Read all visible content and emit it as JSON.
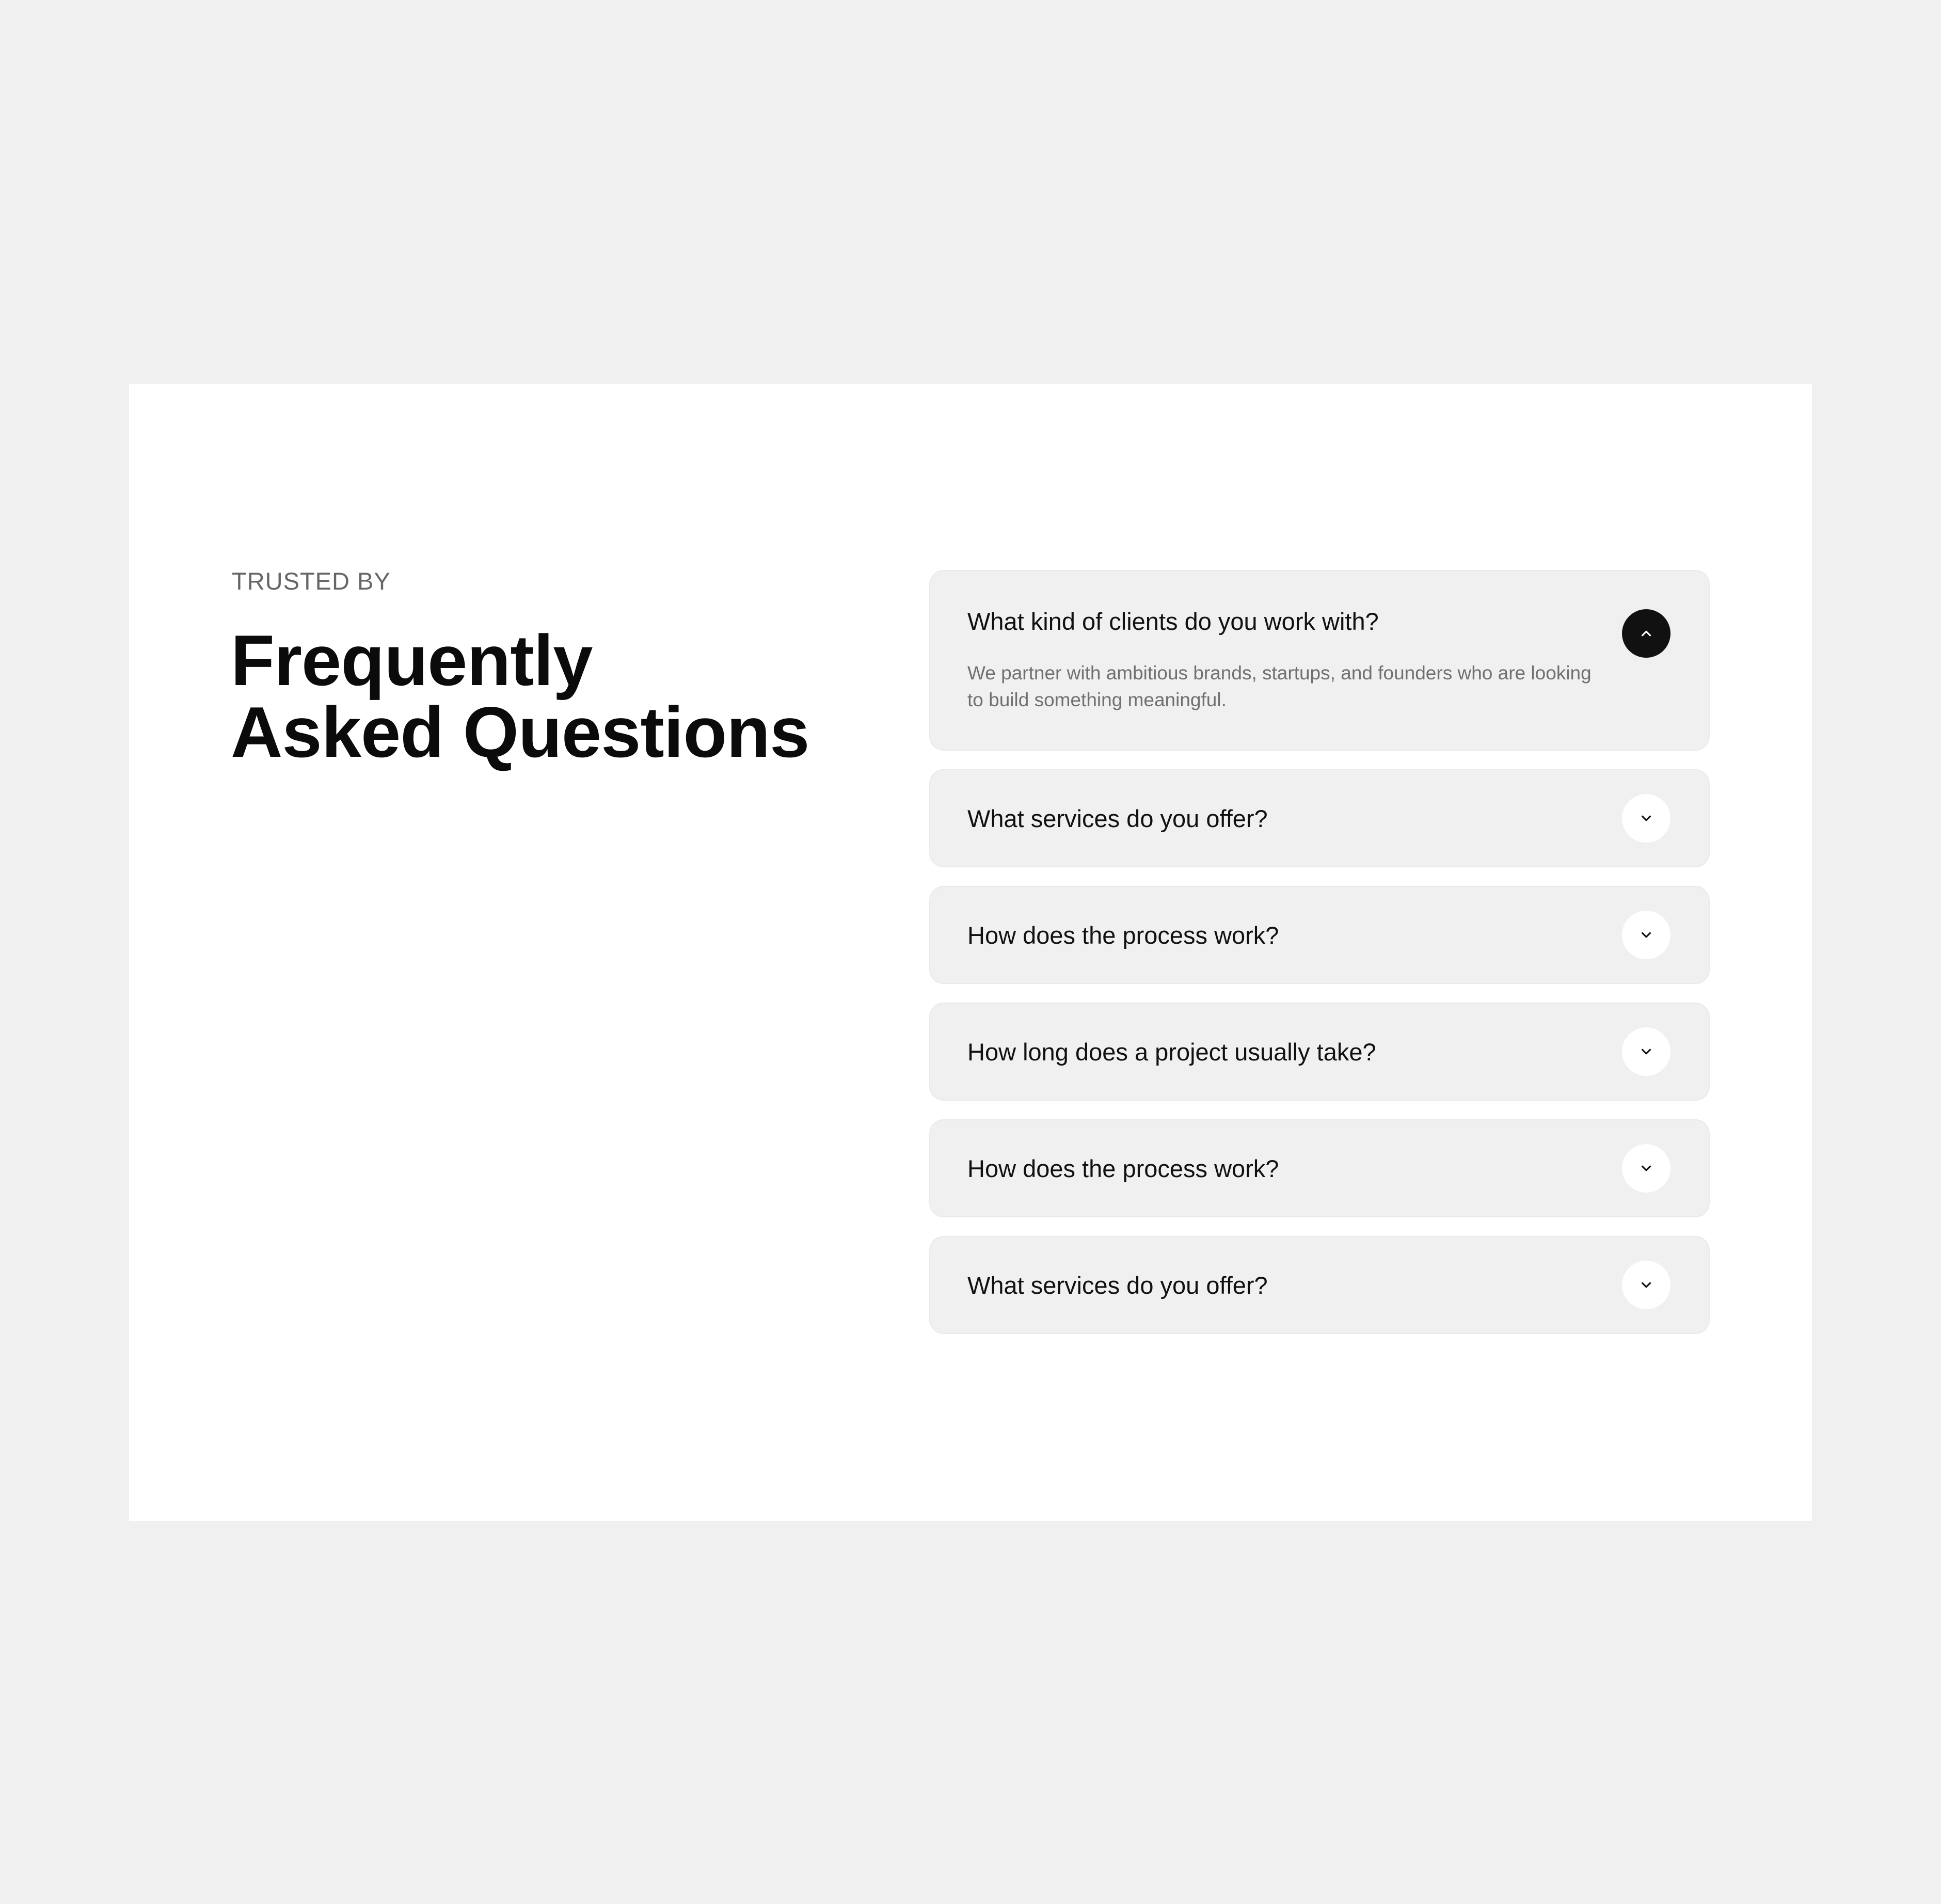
{
  "section": {
    "eyebrow": "TRUSTED BY",
    "title_line1": "Frequently",
    "title_line2": "Asked Questions"
  },
  "faq": {
    "items": [
      {
        "question": "What kind of clients do you work with?",
        "answer": "We partner with ambitious brands, startups, and founders who are looking to build something meaningful.",
        "expanded": true,
        "icon": "chevron-up-icon"
      },
      {
        "question": "What services do you offer?",
        "expanded": false,
        "icon": "chevron-down-icon"
      },
      {
        "question": "How does the process work?",
        "expanded": false,
        "icon": "chevron-down-icon"
      },
      {
        "question": "How long does a project usually take?",
        "expanded": false,
        "icon": "chevron-down-icon"
      },
      {
        "question": "How does the process work?",
        "expanded": false,
        "icon": "chevron-down-icon"
      },
      {
        "question": "What services do you offer?",
        "expanded": false,
        "icon": "chevron-down-icon"
      }
    ]
  },
  "colors": {
    "page_background": "#f0f0f0",
    "card_background": "#ffffff",
    "item_background": "#f0f0f0",
    "active_toggle": "#111111",
    "inactive_toggle": "#ffffff",
    "muted_text": "#707070"
  }
}
